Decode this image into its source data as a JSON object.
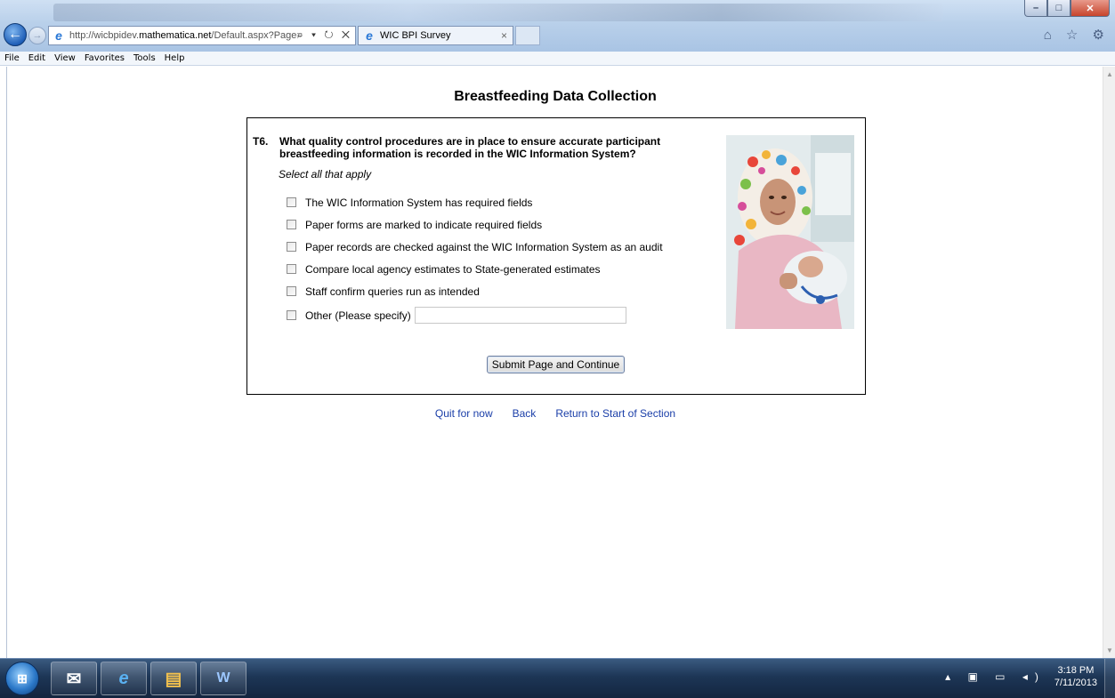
{
  "browser": {
    "url_prefix": "http://wicbpidev.",
    "url_domain": "mathematica.net",
    "url_suffix": "/Default.aspx?Page=",
    "address_tools": "⌕ ▾ ↻ ✕",
    "tab_title": "WIC BPI Survey",
    "tab_close": "×",
    "right_icons": "⌂ ☆ ⚙",
    "window_controls": [
      "–",
      "□",
      "✕"
    ]
  },
  "menu": [
    "File",
    "Edit",
    "View",
    "Favorites",
    "Tools",
    "Help"
  ],
  "page": {
    "title": "Breastfeeding Data Collection",
    "question_number": "T6.",
    "question_text": "What quality control procedures are in place to ensure accurate participant breastfeeding information is recorded in the WIC Information System?",
    "instruction": "Select all that apply",
    "options": [
      {
        "label": "The WIC Information System has required fields",
        "checked": false
      },
      {
        "label": "Paper forms are marked to indicate required fields",
        "checked": false
      },
      {
        "label": "Paper records are checked against the WIC Information System as an audit",
        "checked": false
      },
      {
        "label": "Compare local agency estimates to State-generated estimates",
        "checked": false
      },
      {
        "label": "Staff confirm queries run as intended",
        "checked": false
      }
    ],
    "other_label": "Other (Please specify)",
    "other_value": "",
    "submit_label": "Submit Page and Continue",
    "links": {
      "quit": "Quit for now",
      "back": "Back",
      "return": "Return to Start of Section"
    }
  },
  "taskbar": {
    "apps": [
      "outlook-icon",
      "internet-explorer-icon",
      "file-explorer-icon",
      "word-icon"
    ],
    "time": "3:18 PM",
    "date": "7/11/2013"
  }
}
